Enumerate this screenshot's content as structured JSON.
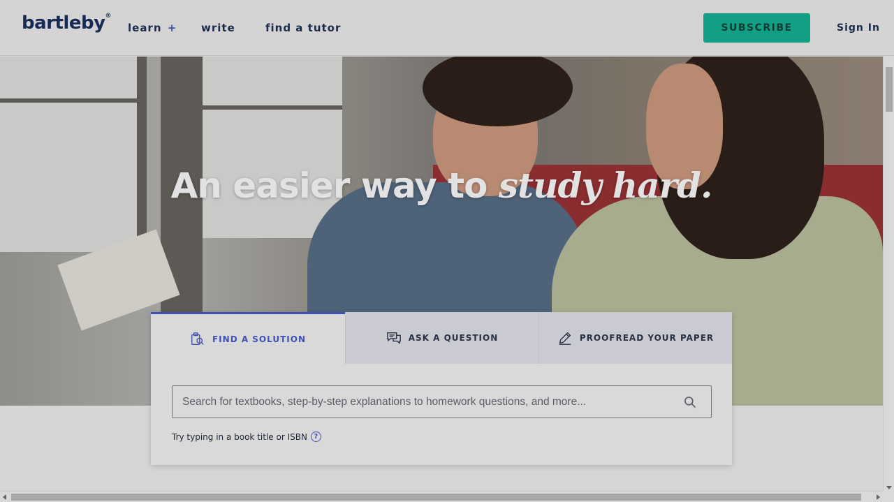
{
  "header": {
    "logo": "bartleby",
    "logo_mark": "®",
    "nav": [
      {
        "label": "learn",
        "suffix": "+"
      },
      {
        "label": "write"
      },
      {
        "label": "find a tutor"
      }
    ],
    "subscribe_label": "SUBSCRIBE",
    "signin_label": "Sign In"
  },
  "hero": {
    "title_plain": "An easier way to ",
    "title_emph": "study hard."
  },
  "search_card": {
    "tabs": [
      {
        "label": "FIND A SOLUTION",
        "icon": "find-solution-icon",
        "active": true
      },
      {
        "label": "ASK A QUESTION",
        "icon": "chat-bubbles-icon",
        "active": false
      },
      {
        "label": "PROOFREAD YOUR PAPER",
        "icon": "pencil-icon",
        "active": false
      }
    ],
    "search_placeholder": "Search for textbooks, step-by-step explanations to homework questions, and more...",
    "hint": "Try typing in a book title or ISBN",
    "hint_icon": "question-circle-icon"
  },
  "colors": {
    "brand_navy": "#172a54",
    "accent_blue": "#3f50b5",
    "subscribe_green": "#139f83"
  }
}
